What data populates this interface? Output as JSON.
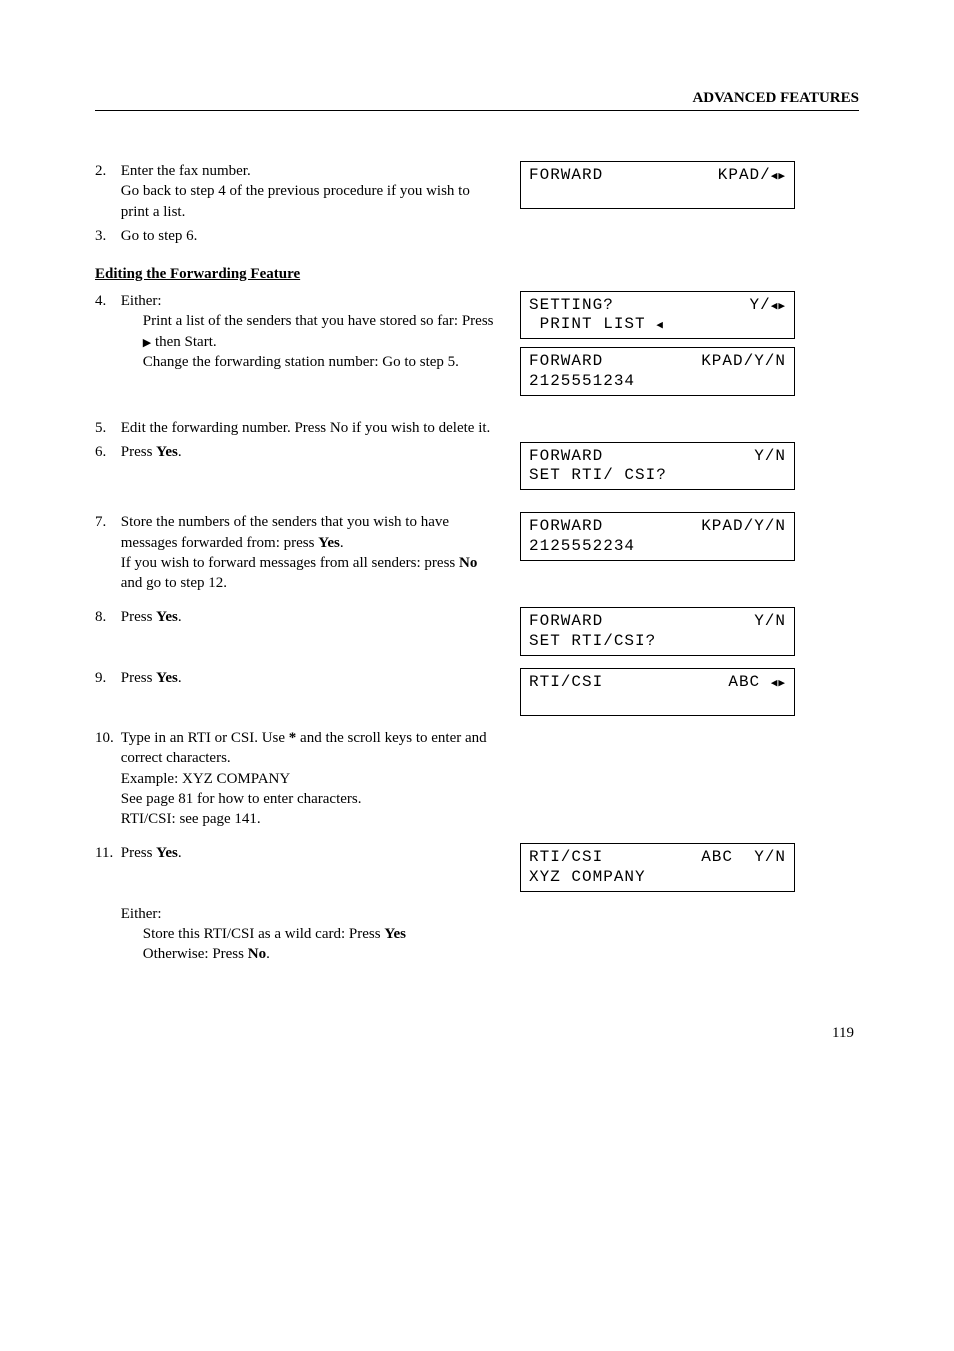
{
  "header": "ADVANCED FEATURES",
  "page_number": "119",
  "steps": {
    "s2": {
      "num": "2.",
      "text_a": "Enter the fax number.",
      "text_b": "Go back to step 4 of the previous procedure if you wish to print a list."
    },
    "s3": {
      "num": "3.",
      "text": "Go to step 6."
    },
    "s4_num": "4.",
    "s4_line1": "Either:",
    "s4_item1_a": "Print a list of the senders that you have stored so far: Press",
    "s4_item1_b": "then Start.",
    "s4_item2": "Change the forwarding station number: Go to step 5.",
    "s5": {
      "num": "5.",
      "text_a": "Edit the forwarding number. Press",
      "text_b": "No if you wish to delete it."
    },
    "s6": {
      "num": "6.",
      "text_a": "Press",
      "text_yes": "Yes",
      "text_b": "."
    },
    "s7": {
      "num": "7.",
      "text_a": "Store the numbers of the senders that you wish to have messages forwarded from: press",
      "text_yes": "Yes",
      "text_b": ".",
      "text_c": "If you wish to forward messages from all senders: press",
      "text_no": "No",
      "text_d": " and go to step 12."
    },
    "s8": {
      "num": "8.",
      "text_a": "Press",
      "text_yes": "Yes",
      "text_b": "."
    },
    "s9": {
      "num": "9.",
      "text_a": "Press",
      "text_yes": "Yes",
      "text_b": "."
    },
    "s10": {
      "num": "10.",
      "text_a": "Type in an RTI or CSI. Use",
      "text_b": "and the scroll keys to enter and correct characters.",
      "text_c": "Example: XYZ COMPANY",
      "text_d": "See page 81 for how to enter characters.",
      "text_e": "RTI/CSI: see page 141."
    },
    "s11": {
      "num": "11.",
      "text_a": "Press",
      "text_yes": "Yes",
      "text_b": "."
    },
    "s12_a": "Either:",
    "s12_b": "Store this RTI/CSI as a wild card: Press",
    "s12_yes": "Yes",
    "s12_c": "Otherwise: Press",
    "s12_no": "No",
    "s12_d": "."
  },
  "section_title": "Editing the Forwarding Feature",
  "lcd": {
    "box1": {
      "l1a": "FORWARD",
      "l1b": "KPAD/"
    },
    "box2": {
      "l1a": "SETTING?",
      "l1b": "Y/",
      "l2a": " PRINT LIST "
    },
    "box3": {
      "l1a": "FORWARD",
      "l1b": "KPAD/Y/N",
      "l2": "2125551234"
    },
    "box4": {
      "l1a": "FORWARD",
      "l1b": "Y/N",
      "l2": "SET RTI/ CSI?"
    },
    "box5": {
      "l1a": "FORWARD",
      "l1b": "KPAD/Y/N",
      "l2": "2125552234"
    },
    "box6": {
      "l1a": "FORWARD",
      "l1b": "Y/N",
      "l2": "SET RTI/CSI?"
    },
    "box7": {
      "l1a": "RTI/CSI",
      "l1b": "ABC "
    },
    "box8": {
      "l1a": "RTI/CSI",
      "l1b": "ABC  Y/N",
      "l2": "XYZ COMPANY"
    }
  }
}
